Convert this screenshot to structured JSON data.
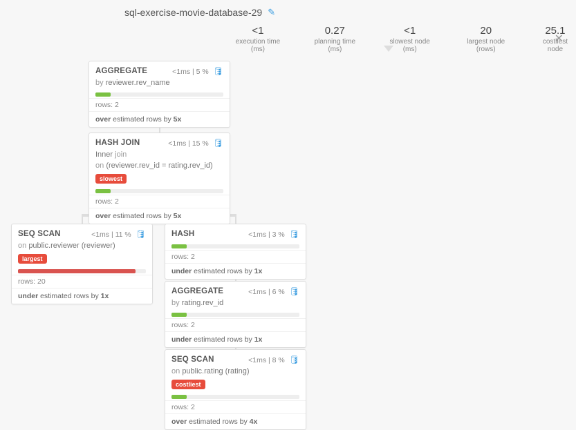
{
  "title": "sql-exercise-movie-database-29",
  "stats": {
    "exec": {
      "value": "<1",
      "label": "execution time (ms)"
    },
    "plan": {
      "value": "0.27",
      "label": "planning time (ms)"
    },
    "slow": {
      "value": "<1",
      "label": "slowest node (ms)"
    },
    "large": {
      "value": "20",
      "label": "largest node (rows)"
    },
    "cost": {
      "value": "25.1",
      "label": "costliest node"
    }
  },
  "nodes": {
    "aggregate1": {
      "name": "AGGREGATE",
      "time": "<1ms",
      "pct": "5 %",
      "sub_prefix": "by",
      "sub": "reviewer.rev_name",
      "bar_color": "green",
      "bar_width": "12%",
      "rows_label": "rows:",
      "rows": "2",
      "est_word": "over",
      "est_text": "estimated rows by",
      "est_factor": "5x"
    },
    "hashjoin": {
      "name": "HASH JOIN",
      "time": "<1ms",
      "pct": "15 %",
      "sub_line1_a": "Inner",
      "sub_line1_b": "join",
      "sub_line2_a": "on",
      "sub_line2_b": "(reviewer.rev_id = rating.rev_id)",
      "badge": "slowest",
      "bar_color": "green",
      "bar_width": "12%",
      "rows_label": "rows:",
      "rows": "2",
      "est_word": "over",
      "est_text": "estimated rows by",
      "est_factor": "5x"
    },
    "seqscan1": {
      "name": "SEQ SCAN",
      "time": "<1ms",
      "pct": "11 %",
      "sub_prefix": "on",
      "sub": "public.reviewer (reviewer)",
      "badge": "largest",
      "bar_color": "red",
      "bar_width": "92%",
      "rows_label": "rows:",
      "rows": "20",
      "est_word": "under",
      "est_text": "estimated rows by",
      "est_factor": "1x"
    },
    "hash": {
      "name": "HASH",
      "time": "<1ms",
      "pct": "3 %",
      "bar_color": "green",
      "bar_width": "12%",
      "rows_label": "rows:",
      "rows": "2",
      "est_word": "under",
      "est_text": "estimated rows by",
      "est_factor": "1x"
    },
    "aggregate2": {
      "name": "AGGREGATE",
      "time": "<1ms",
      "pct": "6 %",
      "sub_prefix": "by",
      "sub": "rating.rev_id",
      "bar_color": "green",
      "bar_width": "12%",
      "rows_label": "rows:",
      "rows": "2",
      "est_word": "under",
      "est_text": "estimated rows by",
      "est_factor": "1x"
    },
    "seqscan2": {
      "name": "SEQ SCAN",
      "time": "<1ms",
      "pct": "8 %",
      "sub_prefix": "on",
      "sub": "public.rating (rating)",
      "badge": "costliest",
      "bar_color": "green",
      "bar_width": "12%",
      "rows_label": "rows:",
      "rows": "2",
      "est_word": "over",
      "est_text": "estimated rows by",
      "est_factor": "4x"
    }
  }
}
